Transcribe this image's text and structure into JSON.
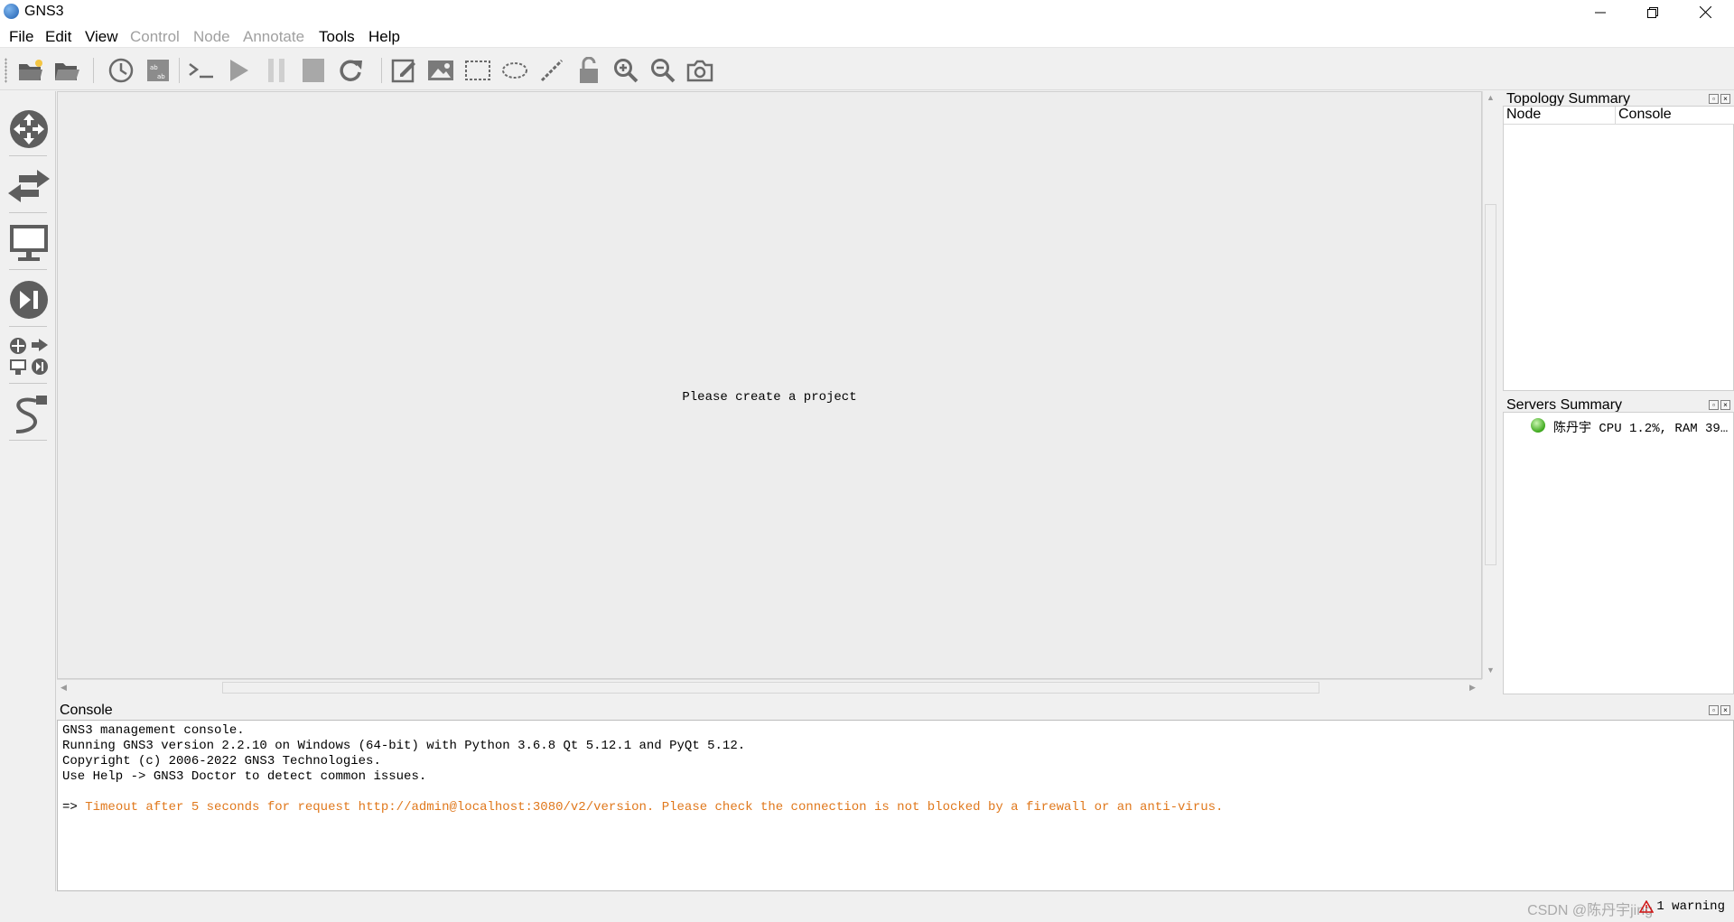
{
  "window": {
    "title": "GNS3"
  },
  "menus": [
    {
      "label": "File",
      "enabled": true
    },
    {
      "label": "Edit",
      "enabled": true
    },
    {
      "label": "View",
      "enabled": true
    },
    {
      "label": "Control",
      "enabled": false
    },
    {
      "label": "Node",
      "enabled": false
    },
    {
      "label": "Annotate",
      "enabled": false
    },
    {
      "label": "Tools",
      "enabled": true
    },
    {
      "label": "Help",
      "enabled": true
    }
  ],
  "toolbar": {
    "icons": [
      "new-project-icon",
      "open-project-icon",
      "snapshot-icon",
      "show-interface-labels-icon",
      "console-all-icon",
      "start-all-icon",
      "suspend-all-icon",
      "stop-all-icon",
      "reload-all-icon",
      "add-note-icon",
      "insert-picture-icon",
      "draw-rectangle-icon",
      "draw-ellipse-icon",
      "draw-line-icon",
      "lock-unlock-icon",
      "zoom-in-icon",
      "zoom-out-icon",
      "screenshot-icon"
    ]
  },
  "left_dock": {
    "icons": [
      "routers-icon",
      "switches-icon",
      "end-devices-icon",
      "security-devices-icon",
      "all-devices-icon",
      "add-link-icon"
    ]
  },
  "canvas": {
    "placeholder": "Please create a project"
  },
  "topology_summary": {
    "title": "Topology Summary",
    "columns": [
      "Node",
      "Console"
    ]
  },
  "servers_summary": {
    "title": "Servers Summary",
    "servers": [
      {
        "text": "陈丹宇 CPU 1.2%, RAM 39…",
        "status": "running",
        "status_color": "#3da81c"
      }
    ]
  },
  "console": {
    "title": "Console",
    "lines": [
      {
        "text": "GNS3 management console.",
        "type": "normal"
      },
      {
        "text": "Running GNS3 version 2.2.10 on Windows (64-bit) with Python 3.6.8 Qt 5.12.1 and PyQt 5.12.",
        "type": "normal"
      },
      {
        "text": "Copyright (c) 2006-2022 GNS3 Technologies.",
        "type": "normal"
      },
      {
        "text": "Use Help -> GNS3 Doctor to detect common issues.",
        "type": "normal"
      },
      {
        "text": "",
        "type": "normal"
      }
    ],
    "warning_prompt": "=> ",
    "warning_text": "Timeout after 5 seconds for request http://admin@localhost:3080/v2/version. Please check the connection is not blocked by a firewall or an anti-virus.",
    "warning_color": "#e0781c"
  },
  "status_bar": {
    "warnings": "1 warning",
    "watermark": "CSDN @陈丹宇jing"
  }
}
